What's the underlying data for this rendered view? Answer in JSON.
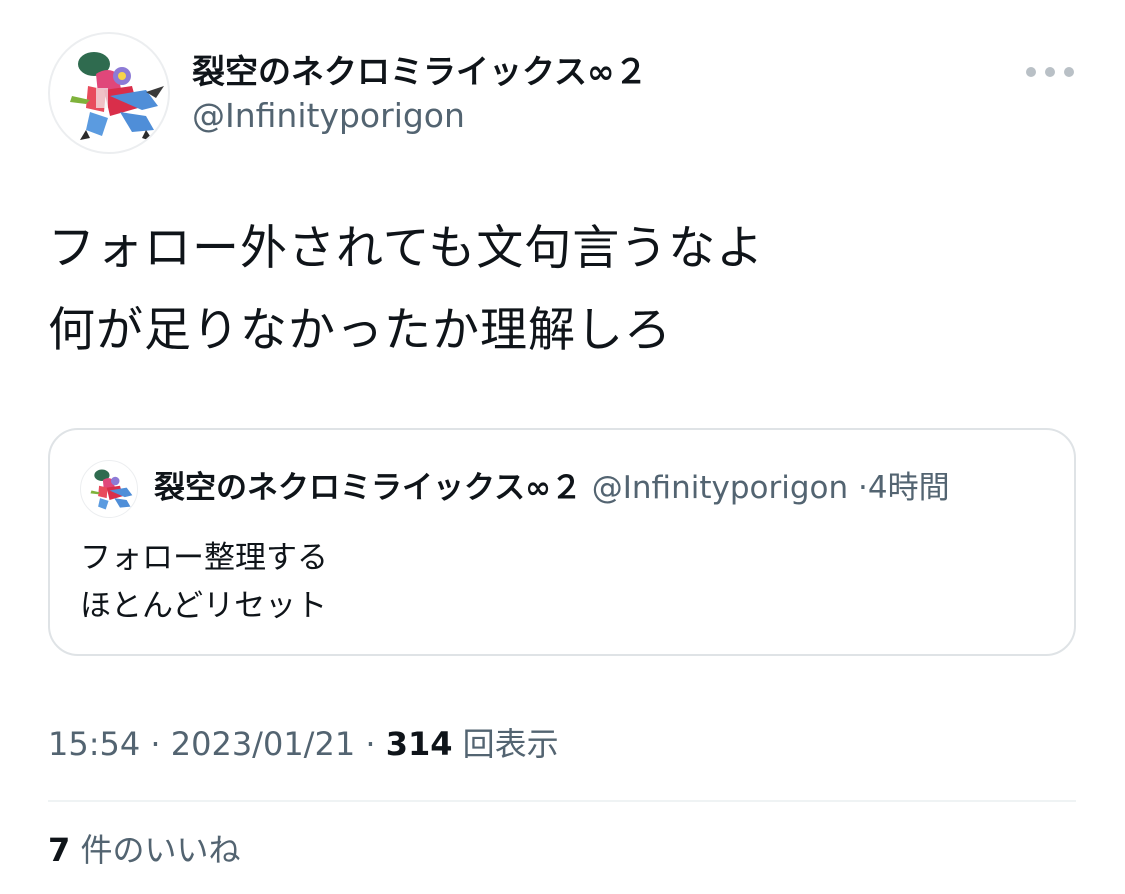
{
  "author": {
    "display_name": "裂空のネクロミライックス∞２",
    "handle": "@Infinityporigon"
  },
  "more_icon": "more-horizontal-icon",
  "tweet": {
    "text_lines": [
      "フォロー外されても文句言うなよ",
      "何が足りなかったか理解しろ"
    ],
    "time": "15:54",
    "date": "2023/01/21",
    "views_count": "314",
    "views_label": "回表示",
    "separator": " · "
  },
  "quote": {
    "display_name": "裂空のネクロミライックス∞２",
    "handle": "@Infinityporigon",
    "separator": "·",
    "relative_time": "4時間",
    "text_lines": [
      "フォロー整理する",
      "ほとんどリセット"
    ]
  },
  "likes": {
    "count": "7",
    "label": "件のいいね"
  },
  "colors": {
    "primary_text": "#0f1419",
    "secondary_text": "#536471",
    "border": "#dfe3e6"
  }
}
